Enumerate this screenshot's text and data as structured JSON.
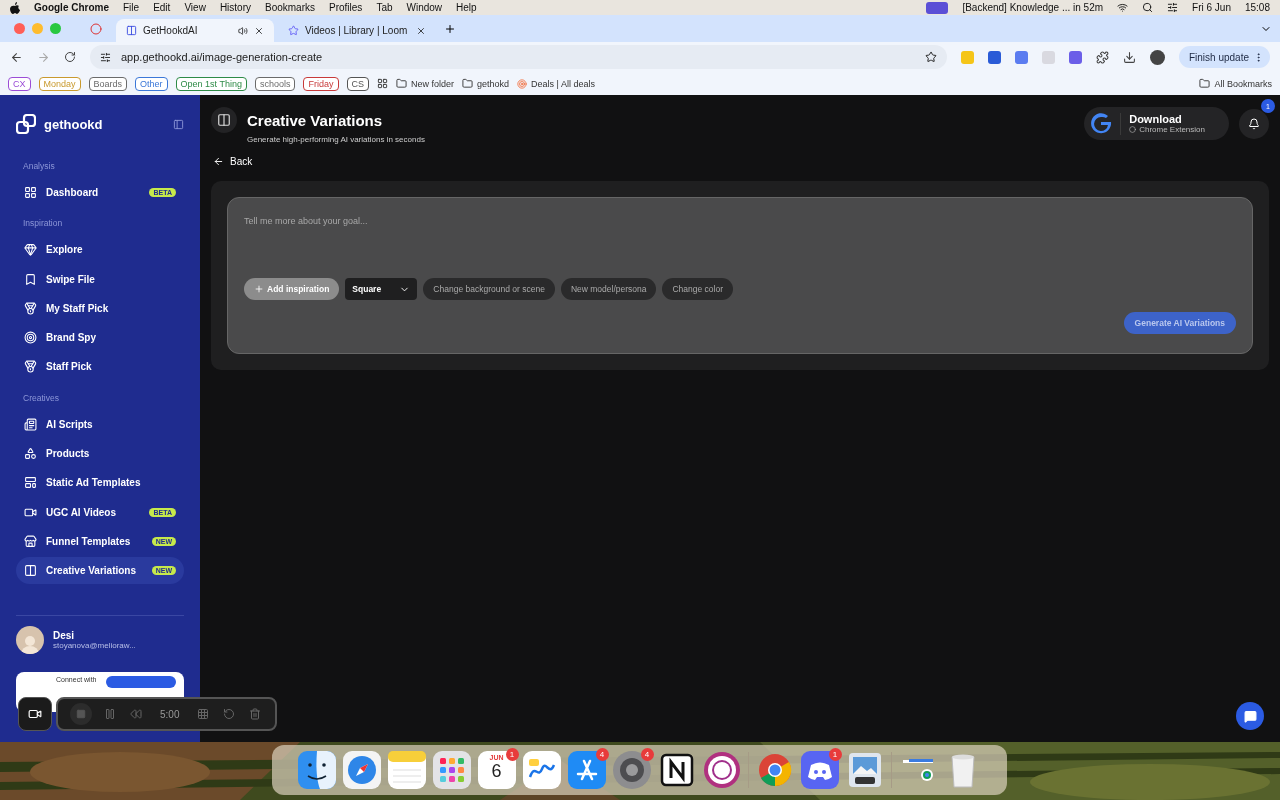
{
  "menubar": {
    "app": "Google Chrome",
    "menus": [
      "File",
      "Edit",
      "View",
      "History",
      "Bookmarks",
      "Profiles",
      "Tab",
      "Window",
      "Help"
    ],
    "event": "[Backend] Knowledge ... in 52m",
    "date": "Fri 6 Jun",
    "time": "15:08"
  },
  "browser": {
    "tabs": [
      {
        "title": "GetHookdAI",
        "selected": true
      },
      {
        "title": "Videos | Library | Loom",
        "selected": false
      }
    ],
    "url": "app.gethookd.ai/image-generation-create",
    "update_button": "Finish update",
    "bookmarks": [
      {
        "kind": "chip",
        "label": "CX",
        "color": "#9b4dd6"
      },
      {
        "kind": "chip",
        "label": "Monday",
        "color": "#c99a2e"
      },
      {
        "kind": "chip",
        "label": "Boards",
        "color": "#6b6b6b"
      },
      {
        "kind": "chip",
        "label": "Other",
        "color": "#3c78d8"
      },
      {
        "kind": "chip",
        "label": "Open 1st Thing",
        "color": "#2e8b47"
      },
      {
        "kind": "chip",
        "label": "schools",
        "color": "#6b6b6b"
      },
      {
        "kind": "chip",
        "label": "Friday",
        "color": "#c83a3a"
      },
      {
        "kind": "chip",
        "label": "CS",
        "color": "#555555"
      },
      {
        "kind": "apps"
      },
      {
        "kind": "folder",
        "label": "New folder"
      },
      {
        "kind": "folder",
        "label": "gethokd"
      },
      {
        "kind": "link",
        "label": "Deals | All deals"
      }
    ],
    "all_bookmarks": "All Bookmarks"
  },
  "sidebar": {
    "brand": "gethookd",
    "sections": [
      {
        "title": "Analysis",
        "items": [
          {
            "label": "Dashboard",
            "badge": "BETA",
            "selected": false
          }
        ]
      },
      {
        "title": "Inspiration",
        "items": [
          {
            "label": "Explore",
            "selected": false
          },
          {
            "label": "Swipe File",
            "selected": false
          },
          {
            "label": "My Staff Pick",
            "selected": false
          },
          {
            "label": "Brand Spy",
            "selected": false
          },
          {
            "label": "Staff Pick",
            "selected": false
          }
        ]
      },
      {
        "title": "Creatives",
        "items": [
          {
            "label": "AI Scripts",
            "selected": false
          },
          {
            "label": "Products",
            "selected": false
          },
          {
            "label": "Static Ad Templates",
            "selected": false
          },
          {
            "label": "UGC AI Videos",
            "badge": "BETA",
            "selected": false
          },
          {
            "label": "Funnel Templates",
            "badge": "NEW",
            "selected": false
          },
          {
            "label": "Creative Variations",
            "badge": "NEW",
            "selected": true
          }
        ]
      }
    ],
    "user": {
      "name": "Desi",
      "email": "stoyanova@melioraw..."
    },
    "promo": {
      "text": "Connect with"
    }
  },
  "header": {
    "title": "Creative Variations",
    "subtitle": "Generate high-performing AI variations in seconds",
    "back": "Back",
    "download": {
      "title": "Download",
      "subtitle": "Chrome Extension"
    },
    "notifications": "1"
  },
  "composer": {
    "placeholder": "Tell me more about your goal...",
    "add_button": "Add inspiration",
    "format": "Square",
    "chips": [
      "Change background or scene",
      "New model/persona",
      "Change color"
    ],
    "submit": "Generate AI Variations"
  },
  "recorder": {
    "time": "5:00"
  },
  "dock": {
    "apps": [
      {
        "kind": "finder"
      },
      {
        "kind": "safari"
      },
      {
        "kind": "notes"
      },
      {
        "kind": "launchpad"
      },
      {
        "kind": "calendar",
        "month": "JUN",
        "day": "6",
        "badge": "1"
      },
      {
        "kind": "freeform"
      },
      {
        "kind": "appstore",
        "badge": "4"
      },
      {
        "kind": "settings",
        "badge": "4"
      },
      {
        "kind": "notion"
      },
      {
        "kind": "ring"
      },
      {
        "kind": "separator"
      },
      {
        "kind": "chrome"
      },
      {
        "kind": "discord",
        "badge": "1"
      },
      {
        "kind": "preview"
      },
      {
        "kind": "separator"
      },
      {
        "kind": "downloads"
      },
      {
        "kind": "trash"
      }
    ]
  }
}
